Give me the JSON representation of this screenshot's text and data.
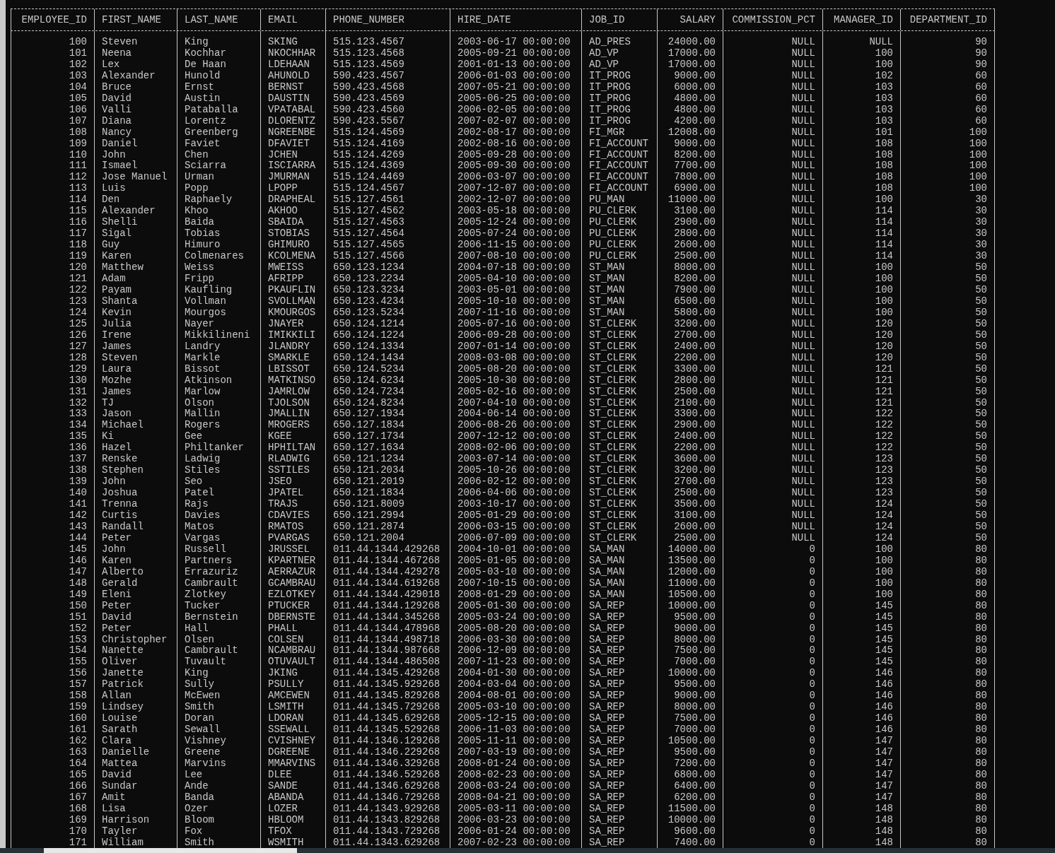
{
  "table": {
    "columns": [
      {
        "label": "EMPLOYEE_ID",
        "kind": "number"
      },
      {
        "label": "FIRST_NAME",
        "kind": "text"
      },
      {
        "label": "LAST_NAME",
        "kind": "text"
      },
      {
        "label": "EMAIL",
        "kind": "text"
      },
      {
        "label": "PHONE_NUMBER",
        "kind": "text"
      },
      {
        "label": "HIRE_DATE",
        "kind": "text"
      },
      {
        "label": "JOB_ID",
        "kind": "text"
      },
      {
        "label": "SALARY",
        "kind": "number"
      },
      {
        "label": "COMMISSION_PCT",
        "kind": "number"
      },
      {
        "label": "MANAGER_ID",
        "kind": "number"
      },
      {
        "label": "DEPARTMENT_ID",
        "kind": "number"
      }
    ],
    "rows": [
      [
        "100",
        "Steven",
        "King",
        "SKING",
        "515.123.4567",
        "2003-06-17 00:00:00",
        "AD_PRES",
        "24000.00",
        "NULL",
        "NULL",
        "90"
      ],
      [
        "101",
        "Neena",
        "Kochhar",
        "NKOCHHAR",
        "515.123.4568",
        "2005-09-21 00:00:00",
        "AD_VP",
        "17000.00",
        "NULL",
        "100",
        "90"
      ],
      [
        "102",
        "Lex",
        "De Haan",
        "LDEHAAN",
        "515.123.4569",
        "2001-01-13 00:00:00",
        "AD_VP",
        "17000.00",
        "NULL",
        "100",
        "90"
      ],
      [
        "103",
        "Alexander",
        "Hunold",
        "AHUNOLD",
        "590.423.4567",
        "2006-01-03 00:00:00",
        "IT_PROG",
        "9000.00",
        "NULL",
        "102",
        "60"
      ],
      [
        "104",
        "Bruce",
        "Ernst",
        "BERNST",
        "590.423.4568",
        "2007-05-21 00:00:00",
        "IT_PROG",
        "6000.00",
        "NULL",
        "103",
        "60"
      ],
      [
        "105",
        "David",
        "Austin",
        "DAUSTIN",
        "590.423.4569",
        "2005-06-25 00:00:00",
        "IT_PROG",
        "4800.00",
        "NULL",
        "103",
        "60"
      ],
      [
        "106",
        "Valli",
        "Pataballa",
        "VPATABAL",
        "590.423.4560",
        "2006-02-05 00:00:00",
        "IT_PROG",
        "4800.00",
        "NULL",
        "103",
        "60"
      ],
      [
        "107",
        "Diana",
        "Lorentz",
        "DLORENTZ",
        "590.423.5567",
        "2007-02-07 00:00:00",
        "IT_PROG",
        "4200.00",
        "NULL",
        "103",
        "60"
      ],
      [
        "108",
        "Nancy",
        "Greenberg",
        "NGREENBE",
        "515.124.4569",
        "2002-08-17 00:00:00",
        "FI_MGR",
        "12008.00",
        "NULL",
        "101",
        "100"
      ],
      [
        "109",
        "Daniel",
        "Faviet",
        "DFAVIET",
        "515.124.4169",
        "2002-08-16 00:00:00",
        "FI_ACCOUNT",
        "9000.00",
        "NULL",
        "108",
        "100"
      ],
      [
        "110",
        "John",
        "Chen",
        "JCHEN",
        "515.124.4269",
        "2005-09-28 00:00:00",
        "FI_ACCOUNT",
        "8200.00",
        "NULL",
        "108",
        "100"
      ],
      [
        "111",
        "Ismael",
        "Sciarra",
        "ISCIARRA",
        "515.124.4369",
        "2005-09-30 00:00:00",
        "FI_ACCOUNT",
        "7700.00",
        "NULL",
        "108",
        "100"
      ],
      [
        "112",
        "Jose Manuel",
        "Urman",
        "JMURMAN",
        "515.124.4469",
        "2006-03-07 00:00:00",
        "FI_ACCOUNT",
        "7800.00",
        "NULL",
        "108",
        "100"
      ],
      [
        "113",
        "Luis",
        "Popp",
        "LPOPP",
        "515.124.4567",
        "2007-12-07 00:00:00",
        "FI_ACCOUNT",
        "6900.00",
        "NULL",
        "108",
        "100"
      ],
      [
        "114",
        "Den",
        "Raphaely",
        "DRAPHEAL",
        "515.127.4561",
        "2002-12-07 00:00:00",
        "PU_MAN",
        "11000.00",
        "NULL",
        "100",
        "30"
      ],
      [
        "115",
        "Alexander",
        "Khoo",
        "AKHOO",
        "515.127.4562",
        "2003-05-18 00:00:00",
        "PU_CLERK",
        "3100.00",
        "NULL",
        "114",
        "30"
      ],
      [
        "116",
        "Shelli",
        "Baida",
        "SBAIDA",
        "515.127.4563",
        "2005-12-24 00:00:00",
        "PU_CLERK",
        "2900.00",
        "NULL",
        "114",
        "30"
      ],
      [
        "117",
        "Sigal",
        "Tobias",
        "STOBIAS",
        "515.127.4564",
        "2005-07-24 00:00:00",
        "PU_CLERK",
        "2800.00",
        "NULL",
        "114",
        "30"
      ],
      [
        "118",
        "Guy",
        "Himuro",
        "GHIMURO",
        "515.127.4565",
        "2006-11-15 00:00:00",
        "PU_CLERK",
        "2600.00",
        "NULL",
        "114",
        "30"
      ],
      [
        "119",
        "Karen",
        "Colmenares",
        "KCOLMENA",
        "515.127.4566",
        "2007-08-10 00:00:00",
        "PU_CLERK",
        "2500.00",
        "NULL",
        "114",
        "30"
      ],
      [
        "120",
        "Matthew",
        "Weiss",
        "MWEISS",
        "650.123.1234",
        "2004-07-18 00:00:00",
        "ST_MAN",
        "8000.00",
        "NULL",
        "100",
        "50"
      ],
      [
        "121",
        "Adam",
        "Fripp",
        "AFRIPP",
        "650.123.2234",
        "2005-04-10 00:00:00",
        "ST_MAN",
        "8200.00",
        "NULL",
        "100",
        "50"
      ],
      [
        "122",
        "Payam",
        "Kaufling",
        "PKAUFLIN",
        "650.123.3234",
        "2003-05-01 00:00:00",
        "ST_MAN",
        "7900.00",
        "NULL",
        "100",
        "50"
      ],
      [
        "123",
        "Shanta",
        "Vollman",
        "SVOLLMAN",
        "650.123.4234",
        "2005-10-10 00:00:00",
        "ST_MAN",
        "6500.00",
        "NULL",
        "100",
        "50"
      ],
      [
        "124",
        "Kevin",
        "Mourgos",
        "KMOURGOS",
        "650.123.5234",
        "2007-11-16 00:00:00",
        "ST_MAN",
        "5800.00",
        "NULL",
        "100",
        "50"
      ],
      [
        "125",
        "Julia",
        "Nayer",
        "JNAYER",
        "650.124.1214",
        "2005-07-16 00:00:00",
        "ST_CLERK",
        "3200.00",
        "NULL",
        "120",
        "50"
      ],
      [
        "126",
        "Irene",
        "Mikkilineni",
        "IMIKKILI",
        "650.124.1224",
        "2006-09-28 00:00:00",
        "ST_CLERK",
        "2700.00",
        "NULL",
        "120",
        "50"
      ],
      [
        "127",
        "James",
        "Landry",
        "JLANDRY",
        "650.124.1334",
        "2007-01-14 00:00:00",
        "ST_CLERK",
        "2400.00",
        "NULL",
        "120",
        "50"
      ],
      [
        "128",
        "Steven",
        "Markle",
        "SMARKLE",
        "650.124.1434",
        "2008-03-08 00:00:00",
        "ST_CLERK",
        "2200.00",
        "NULL",
        "120",
        "50"
      ],
      [
        "129",
        "Laura",
        "Bissot",
        "LBISSOT",
        "650.124.5234",
        "2005-08-20 00:00:00",
        "ST_CLERK",
        "3300.00",
        "NULL",
        "121",
        "50"
      ],
      [
        "130",
        "Mozhe",
        "Atkinson",
        "MATKINSO",
        "650.124.6234",
        "2005-10-30 00:00:00",
        "ST_CLERK",
        "2800.00",
        "NULL",
        "121",
        "50"
      ],
      [
        "131",
        "James",
        "Marlow",
        "JAMRLOW",
        "650.124.7234",
        "2005-02-16 00:00:00",
        "ST_CLERK",
        "2500.00",
        "NULL",
        "121",
        "50"
      ],
      [
        "132",
        "TJ",
        "Olson",
        "TJOLSON",
        "650.124.8234",
        "2007-04-10 00:00:00",
        "ST_CLERK",
        "2100.00",
        "NULL",
        "121",
        "50"
      ],
      [
        "133",
        "Jason",
        "Mallin",
        "JMALLIN",
        "650.127.1934",
        "2004-06-14 00:00:00",
        "ST_CLERK",
        "3300.00",
        "NULL",
        "122",
        "50"
      ],
      [
        "134",
        "Michael",
        "Rogers",
        "MROGERS",
        "650.127.1834",
        "2006-08-26 00:00:00",
        "ST_CLERK",
        "2900.00",
        "NULL",
        "122",
        "50"
      ],
      [
        "135",
        "Ki",
        "Gee",
        "KGEE",
        "650.127.1734",
        "2007-12-12 00:00:00",
        "ST_CLERK",
        "2400.00",
        "NULL",
        "122",
        "50"
      ],
      [
        "136",
        "Hazel",
        "Philtanker",
        "HPHILTAN",
        "650.127.1634",
        "2008-02-06 00:00:00",
        "ST_CLERK",
        "2200.00",
        "NULL",
        "122",
        "50"
      ],
      [
        "137",
        "Renske",
        "Ladwig",
        "RLADWIG",
        "650.121.1234",
        "2003-07-14 00:00:00",
        "ST_CLERK",
        "3600.00",
        "NULL",
        "123",
        "50"
      ],
      [
        "138",
        "Stephen",
        "Stiles",
        "SSTILES",
        "650.121.2034",
        "2005-10-26 00:00:00",
        "ST_CLERK",
        "3200.00",
        "NULL",
        "123",
        "50"
      ],
      [
        "139",
        "John",
        "Seo",
        "JSEO",
        "650.121.2019",
        "2006-02-12 00:00:00",
        "ST_CLERK",
        "2700.00",
        "NULL",
        "123",
        "50"
      ],
      [
        "140",
        "Joshua",
        "Patel",
        "JPATEL",
        "650.121.1834",
        "2006-04-06 00:00:00",
        "ST_CLERK",
        "2500.00",
        "NULL",
        "123",
        "50"
      ],
      [
        "141",
        "Trenna",
        "Rajs",
        "TRAJS",
        "650.121.8009",
        "2003-10-17 00:00:00",
        "ST_CLERK",
        "3500.00",
        "NULL",
        "124",
        "50"
      ],
      [
        "142",
        "Curtis",
        "Davies",
        "CDAVIES",
        "650.121.2994",
        "2005-01-29 00:00:00",
        "ST_CLERK",
        "3100.00",
        "NULL",
        "124",
        "50"
      ],
      [
        "143",
        "Randall",
        "Matos",
        "RMATOS",
        "650.121.2874",
        "2006-03-15 00:00:00",
        "ST_CLERK",
        "2600.00",
        "NULL",
        "124",
        "50"
      ],
      [
        "144",
        "Peter",
        "Vargas",
        "PVARGAS",
        "650.121.2004",
        "2006-07-09 00:00:00",
        "ST_CLERK",
        "2500.00",
        "NULL",
        "124",
        "50"
      ],
      [
        "145",
        "John",
        "Russell",
        "JRUSSEL",
        "011.44.1344.429268",
        "2004-10-01 00:00:00",
        "SA_MAN",
        "14000.00",
        "0",
        "100",
        "80"
      ],
      [
        "146",
        "Karen",
        "Partners",
        "KPARTNER",
        "011.44.1344.467268",
        "2005-01-05 00:00:00",
        "SA_MAN",
        "13500.00",
        "0",
        "100",
        "80"
      ],
      [
        "147",
        "Alberto",
        "Errazuriz",
        "AERRAZUR",
        "011.44.1344.429278",
        "2005-03-10 00:00:00",
        "SA_MAN",
        "12000.00",
        "0",
        "100",
        "80"
      ],
      [
        "148",
        "Gerald",
        "Cambrault",
        "GCAMBRAU",
        "011.44.1344.619268",
        "2007-10-15 00:00:00",
        "SA_MAN",
        "11000.00",
        "0",
        "100",
        "80"
      ],
      [
        "149",
        "Eleni",
        "Zlotkey",
        "EZLOTKEY",
        "011.44.1344.429018",
        "2008-01-29 00:00:00",
        "SA_MAN",
        "10500.00",
        "0",
        "100",
        "80"
      ],
      [
        "150",
        "Peter",
        "Tucker",
        "PTUCKER",
        "011.44.1344.129268",
        "2005-01-30 00:00:00",
        "SA_REP",
        "10000.00",
        "0",
        "145",
        "80"
      ],
      [
        "151",
        "David",
        "Bernstein",
        "DBERNSTE",
        "011.44.1344.345268",
        "2005-03-24 00:00:00",
        "SA_REP",
        "9500.00",
        "0",
        "145",
        "80"
      ],
      [
        "152",
        "Peter",
        "Hall",
        "PHALL",
        "011.44.1344.478968",
        "2005-08-20 00:00:00",
        "SA_REP",
        "9000.00",
        "0",
        "145",
        "80"
      ],
      [
        "153",
        "Christopher",
        "Olsen",
        "COLSEN",
        "011.44.1344.498718",
        "2006-03-30 00:00:00",
        "SA_REP",
        "8000.00",
        "0",
        "145",
        "80"
      ],
      [
        "154",
        "Nanette",
        "Cambrault",
        "NCAMBRAU",
        "011.44.1344.987668",
        "2006-12-09 00:00:00",
        "SA_REP",
        "7500.00",
        "0",
        "145",
        "80"
      ],
      [
        "155",
        "Oliver",
        "Tuvault",
        "OTUVAULT",
        "011.44.1344.486508",
        "2007-11-23 00:00:00",
        "SA_REP",
        "7000.00",
        "0",
        "145",
        "80"
      ],
      [
        "156",
        "Janette",
        "King",
        "JKING",
        "011.44.1345.429268",
        "2004-01-30 00:00:00",
        "SA_REP",
        "10000.00",
        "0",
        "146",
        "80"
      ],
      [
        "157",
        "Patrick",
        "Sully",
        "PSULLY",
        "011.44.1345.929268",
        "2004-03-04 00:00:00",
        "SA_REP",
        "9500.00",
        "0",
        "146",
        "80"
      ],
      [
        "158",
        "Allan",
        "McEwen",
        "AMCEWEN",
        "011.44.1345.829268",
        "2004-08-01 00:00:00",
        "SA_REP",
        "9000.00",
        "0",
        "146",
        "80"
      ],
      [
        "159",
        "Lindsey",
        "Smith",
        "LSMITH",
        "011.44.1345.729268",
        "2005-03-10 00:00:00",
        "SA_REP",
        "8000.00",
        "0",
        "146",
        "80"
      ],
      [
        "160",
        "Louise",
        "Doran",
        "LDORAN",
        "011.44.1345.629268",
        "2005-12-15 00:00:00",
        "SA_REP",
        "7500.00",
        "0",
        "146",
        "80"
      ],
      [
        "161",
        "Sarath",
        "Sewall",
        "SSEWALL",
        "011.44.1345.529268",
        "2006-11-03 00:00:00",
        "SA_REP",
        "7000.00",
        "0",
        "146",
        "80"
      ],
      [
        "162",
        "Clara",
        "Vishney",
        "CVISHNEY",
        "011.44.1346.129268",
        "2005-11-11 00:00:00",
        "SA_REP",
        "10500.00",
        "0",
        "147",
        "80"
      ],
      [
        "163",
        "Danielle",
        "Greene",
        "DGREENE",
        "011.44.1346.229268",
        "2007-03-19 00:00:00",
        "SA_REP",
        "9500.00",
        "0",
        "147",
        "80"
      ],
      [
        "164",
        "Mattea",
        "Marvins",
        "MMARVINS",
        "011.44.1346.329268",
        "2008-01-24 00:00:00",
        "SA_REP",
        "7200.00",
        "0",
        "147",
        "80"
      ],
      [
        "165",
        "David",
        "Lee",
        "DLEE",
        "011.44.1346.529268",
        "2008-02-23 00:00:00",
        "SA_REP",
        "6800.00",
        "0",
        "147",
        "80"
      ],
      [
        "166",
        "Sundar",
        "Ande",
        "SANDE",
        "011.44.1346.629268",
        "2008-03-24 00:00:00",
        "SA_REP",
        "6400.00",
        "0",
        "147",
        "80"
      ],
      [
        "167",
        "Amit",
        "Banda",
        "ABANDA",
        "011.44.1346.729268",
        "2008-04-21 00:00:00",
        "SA_REP",
        "6200.00",
        "0",
        "147",
        "80"
      ],
      [
        "168",
        "Lisa",
        "Ozer",
        "LOZER",
        "011.44.1343.929268",
        "2005-03-11 00:00:00",
        "SA_REP",
        "11500.00",
        "0",
        "148",
        "80"
      ],
      [
        "169",
        "Harrison",
        "Bloom",
        "HBLOOM",
        "011.44.1343.829268",
        "2006-03-23 00:00:00",
        "SA_REP",
        "10000.00",
        "0",
        "148",
        "80"
      ],
      [
        "170",
        "Tayler",
        "Fox",
        "TFOX",
        "011.44.1343.729268",
        "2006-01-24 00:00:00",
        "SA_REP",
        "9600.00",
        "0",
        "148",
        "80"
      ],
      [
        "171",
        "William",
        "Smith",
        "WSMITH",
        "011.44.1343.629268",
        "2007-02-23 00:00:00",
        "SA_REP",
        "7400.00",
        "0",
        "148",
        "80"
      ]
    ]
  }
}
